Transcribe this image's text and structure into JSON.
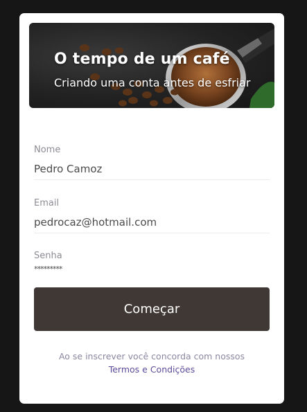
{
  "hero": {
    "title": "O tempo de um café",
    "subtitle": "Criando uma conta antes de esfriar",
    "image_icon": "coffee-portafilter-image"
  },
  "form": {
    "name": {
      "label": "Nome",
      "value": "Pedro Camoz"
    },
    "email": {
      "label": "Email",
      "value": "pedrocaz@hotmail.com"
    },
    "password": {
      "label": "Senha",
      "value": "*********"
    },
    "submit_label": "Começar"
  },
  "terms": {
    "text": "Ao se inscrever você concorda com nossos",
    "link_label": "Termos e Condições"
  },
  "colors": {
    "page_bg": "#161616",
    "card_bg": "#ffffff",
    "button_bg": "#403834",
    "link": "#5b4a9a",
    "label": "#8c8c94"
  }
}
